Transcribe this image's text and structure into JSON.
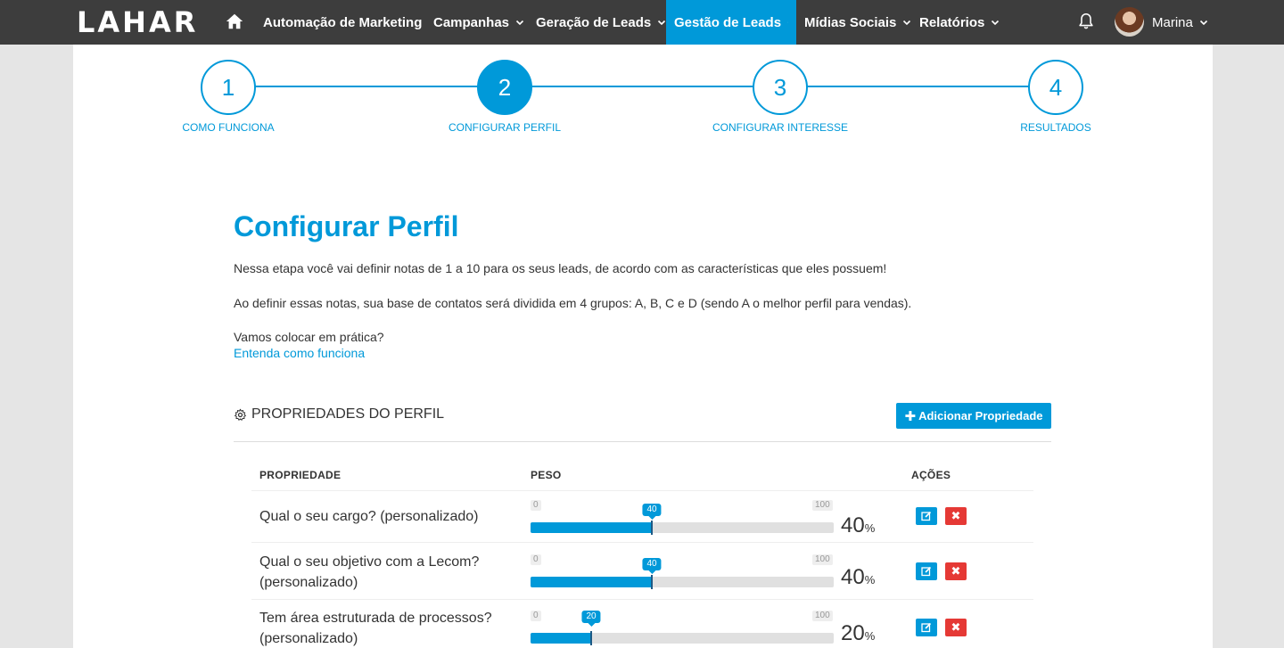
{
  "nav": {
    "logo": "LAHAR",
    "items": [
      {
        "label": "Automação de Marketing",
        "has_menu": false,
        "active": false
      },
      {
        "label": "Campanhas",
        "has_menu": true,
        "active": false
      },
      {
        "label": "Geração de Leads",
        "has_menu": true,
        "active": false
      },
      {
        "label": "Gestão de Leads",
        "has_menu": true,
        "active": true
      },
      {
        "label": "Mídias Sociais",
        "has_menu": true,
        "active": false
      },
      {
        "label": "Relatórios",
        "has_menu": true,
        "active": false
      }
    ],
    "user_name": "Marina"
  },
  "stepper": {
    "steps": [
      {
        "number": "1",
        "label": "COMO FUNCIONA",
        "active": false
      },
      {
        "number": "2",
        "label": "CONFIGURAR PERFIL",
        "active": true
      },
      {
        "number": "3",
        "label": "CONFIGURAR INTERESSE",
        "active": false
      },
      {
        "number": "4",
        "label": "RESULTADOS",
        "active": false
      }
    ]
  },
  "main": {
    "title": "Configurar Perfil",
    "para1": "Nessa etapa você vai definir notas de 1 a 10 para os seus leads, de acordo com as características que eles possuem!",
    "para2": "Ao definir essas notas, sua base de contatos será dividida em 4 grupos: A, B, C e D (sendo A o melhor perfil para vendas).",
    "para3": "Vamos colocar em prática?",
    "link": "Entenda como funciona"
  },
  "properties": {
    "section_title": "PROPRIEDADES DO PERFIL",
    "add_button": "Adicionar Propriedade",
    "headers": {
      "property": "PROPRIEDADE",
      "weight": "PESO",
      "actions": "AÇÕES"
    },
    "slider_min": "0",
    "slider_max": "100",
    "rows": [
      {
        "name": "Qual o seu cargo? (personalizado)",
        "weight": 40
      },
      {
        "name": "Qual o seu objetivo com a Lecom? (personalizado)",
        "weight": 40
      },
      {
        "name": "Tem área estruturada de processos? (personalizado)",
        "weight": 20
      }
    ]
  },
  "colors": {
    "accent": "#0099d9",
    "navbar": "#3d3d3d",
    "danger": "#e53935"
  }
}
